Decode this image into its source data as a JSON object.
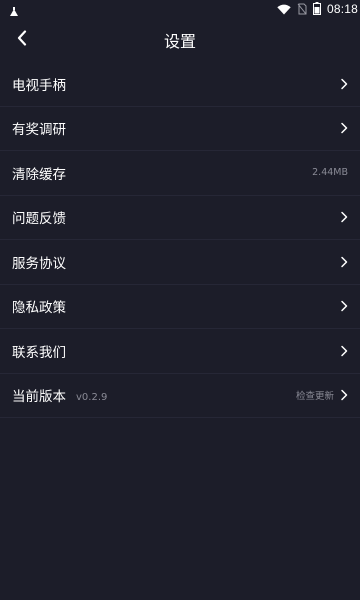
{
  "status_bar": {
    "time": "08:18"
  },
  "header": {
    "title": "设置",
    "back_icon": "chevron-left-icon"
  },
  "settings": {
    "items": [
      {
        "label": "电视手柄",
        "value": "",
        "has_chevron": true
      },
      {
        "label": "有奖调研",
        "value": "",
        "has_chevron": true
      },
      {
        "label": "清除缓存",
        "value": "2.44MB",
        "has_chevron": false
      },
      {
        "label": "问题反馈",
        "value": "",
        "has_chevron": true
      },
      {
        "label": "服务协议",
        "value": "",
        "has_chevron": true
      },
      {
        "label": "隐私政策",
        "value": "",
        "has_chevron": true
      },
      {
        "label": "联系我们",
        "value": "",
        "has_chevron": true
      },
      {
        "label": "当前版本",
        "version": "v0.2.9",
        "value": "检查更新",
        "has_chevron": true
      }
    ]
  },
  "colors": {
    "background": "#1c1d29",
    "divider": "#262736",
    "secondary_text": "#8a8b96"
  }
}
